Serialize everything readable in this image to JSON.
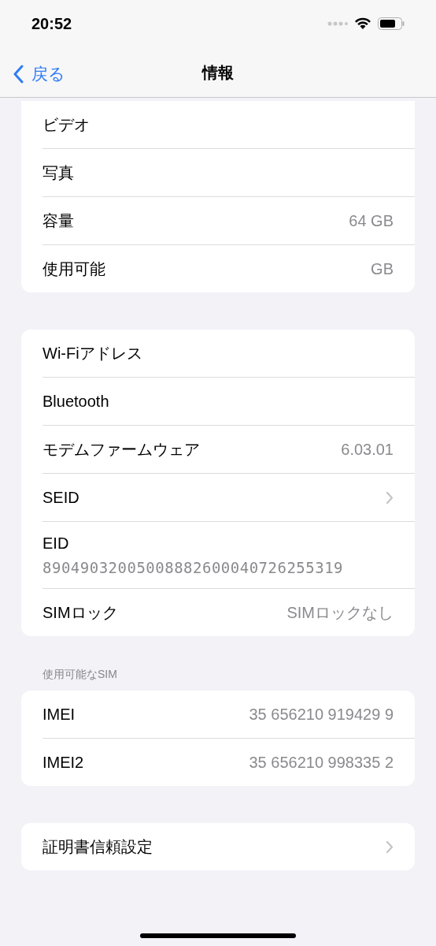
{
  "status_bar": {
    "time": "20:52"
  },
  "nav": {
    "back": "戻る",
    "title": "情報"
  },
  "groups": [
    {
      "cut_top": true,
      "rows": [
        {
          "kind": "value",
          "label": "ビデオ"
        },
        {
          "kind": "value",
          "label": "写真"
        },
        {
          "kind": "value",
          "label": "容量",
          "value": "64 GB"
        },
        {
          "kind": "value",
          "label": "使用可能",
          "value": "GB"
        }
      ]
    },
    {
      "rows": [
        {
          "kind": "value",
          "label": "Wi-Fiアドレス"
        },
        {
          "kind": "value",
          "label": "Bluetooth"
        },
        {
          "kind": "value",
          "label": "モデムファームウェア",
          "value": "6.03.01"
        },
        {
          "kind": "link",
          "label": "SEID"
        },
        {
          "kind": "stacked",
          "label": "EID",
          "value": "89049032005008882600040726255319"
        },
        {
          "kind": "value",
          "label": "SIMロック",
          "value": "SIMロックなし"
        }
      ]
    },
    {
      "header": "使用可能なSIM",
      "rows": [
        {
          "kind": "value",
          "label": "IMEI",
          "value": "35 656210 919429 9"
        },
        {
          "kind": "value",
          "label": "IMEI2",
          "value": "35 656210 998335 2"
        }
      ]
    },
    {
      "rows": [
        {
          "kind": "link",
          "label": "証明書信頼設定"
        }
      ]
    }
  ]
}
